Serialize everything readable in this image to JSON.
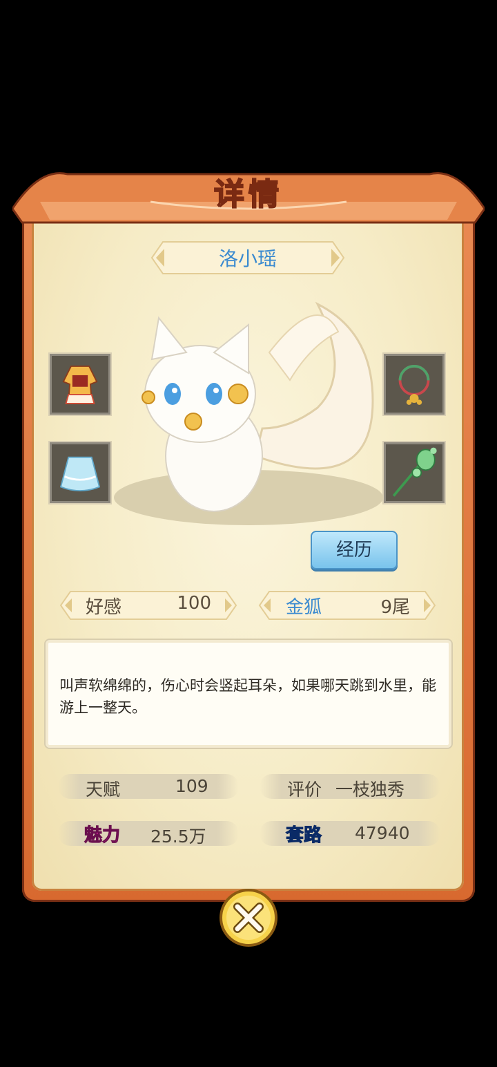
{
  "dialog": {
    "title": "详情"
  },
  "pet": {
    "name": "洛小瑶",
    "description": "叫声软绵绵的，伤心时会竖起耳朵，如果哪天跳到水里，能游上一整天。"
  },
  "equipment": {
    "left": [
      {
        "icon": "dress-icon"
      },
      {
        "icon": "skirt-icon"
      }
    ],
    "right": [
      {
        "icon": "bracelet-icon"
      },
      {
        "icon": "hairpin-icon"
      }
    ]
  },
  "actions": {
    "experience_label": "经历"
  },
  "stats": {
    "affinity": {
      "label": "好感",
      "value": "100"
    },
    "type": {
      "label": "金狐",
      "value": "9尾"
    },
    "talent": {
      "label": "天赋",
      "value": "109"
    },
    "rating": {
      "label": "评价",
      "value": "一枝独秀"
    },
    "charm": {
      "label": "魅力",
      "value": "25.5万"
    },
    "tactics": {
      "label": "套路",
      "value": "47940"
    }
  },
  "colors": {
    "accent_blue": "#3a8ad0",
    "rating_red": "#d8452d",
    "charm_pink": "#d61fa0",
    "tactics_blue": "#1e5fd0"
  }
}
